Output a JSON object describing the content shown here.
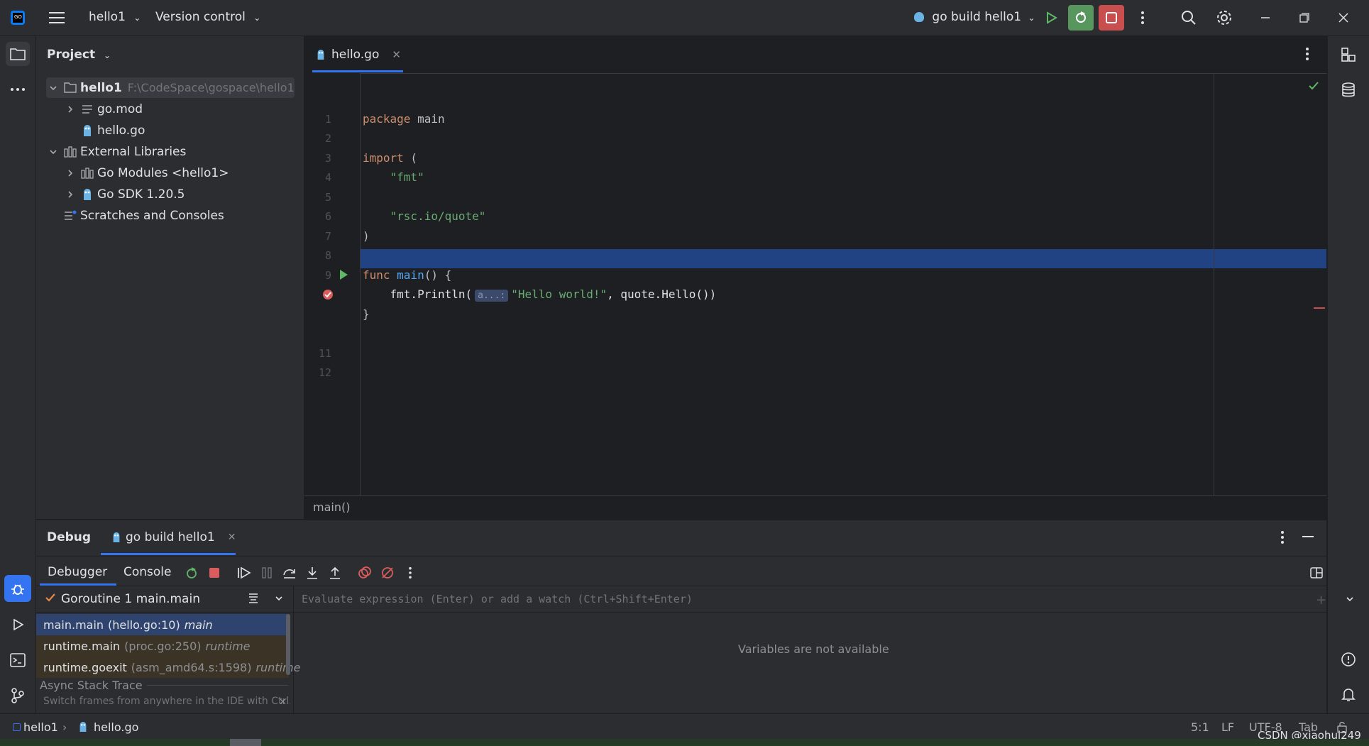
{
  "titlebar": {
    "project": "hello1",
    "vcs": "Version control",
    "run_config": "go build hello1"
  },
  "sidebar_left": {
    "project_icon": "folder-icon",
    "more_icon": "more-horizontal-icon",
    "debug_icon": "bug-icon",
    "run_icon": "play-icon",
    "terminal_icon": "terminal-icon",
    "git_icon": "git-branch-icon"
  },
  "project_panel": {
    "title": "Project",
    "tree": [
      {
        "label": "hello1",
        "hint": "F:\\CodeSpace\\gospace\\hello1",
        "icon": "folder-icon"
      },
      {
        "label": "go.mod",
        "icon": "file-lines-icon"
      },
      {
        "label": "hello.go",
        "icon": "gopher-icon"
      },
      {
        "label": "External Libraries",
        "icon": "library-icon"
      },
      {
        "label": "Go Modules <hello1>",
        "icon": "library-icon"
      },
      {
        "label": "Go SDK 1.20.5",
        "icon": "gopher-icon"
      },
      {
        "label": "Scratches and Consoles",
        "icon": "scratches-icon"
      }
    ]
  },
  "editor": {
    "tab": "hello.go",
    "line_numbers": [
      "1",
      "2",
      "3",
      "4",
      "5",
      "6",
      "7",
      "8",
      "9",
      "",
      "11",
      "12"
    ],
    "code": {
      "l1_kw": "package",
      "l1_rest": " main",
      "l3_kw": "import",
      "l3_rest": " (",
      "l4": "    \"fmt\"",
      "l6": "    \"rsc.io/quote\"",
      "l7": ")",
      "l9_kw": "func",
      "l9_fn": " main",
      "l9_rest": "() {",
      "l10_a": "    fmt.Println(",
      "l10_hint": "a...:",
      "l10_b": "\"Hello world!\"",
      "l10_c": ", quote.Hello())",
      "l11": "}"
    },
    "breadcrumb": "main()"
  },
  "debug": {
    "title": "Debug",
    "session_tab": "go build hello1",
    "tabs": {
      "debugger": "Debugger",
      "console": "Console"
    },
    "goroutine": "Goroutine 1 main.main",
    "frames": [
      {
        "fn": "main.main",
        "loc": "(hello.go:10)",
        "kind": "main"
      },
      {
        "fn": "runtime.main",
        "loc": "(proc.go:250)",
        "kind": "runtime"
      },
      {
        "fn": "runtime.goexit",
        "loc": "(asm_amd64.s:1598)",
        "kind": "runtime"
      }
    ],
    "async_title": "Async Stack Trace",
    "async_hint": "Switch frames from anywhere in the IDE with Ctrl...",
    "eval_placeholder": "Evaluate expression (Enter) or add a watch (Ctrl+Shift+Enter)",
    "variables_empty": "Variables are not available"
  },
  "statusbar": {
    "crumb_project": "hello1",
    "crumb_file": "hello.go",
    "position": "5:1",
    "line_sep": "LF",
    "encoding": "UTF-8",
    "indent": "Tab",
    "watermark": "CSDN @xiaohui249"
  },
  "colors": {
    "accent": "#3574f0",
    "current_line": "#214283",
    "run_green": "#57965c",
    "stop_red": "#c94f4f"
  }
}
